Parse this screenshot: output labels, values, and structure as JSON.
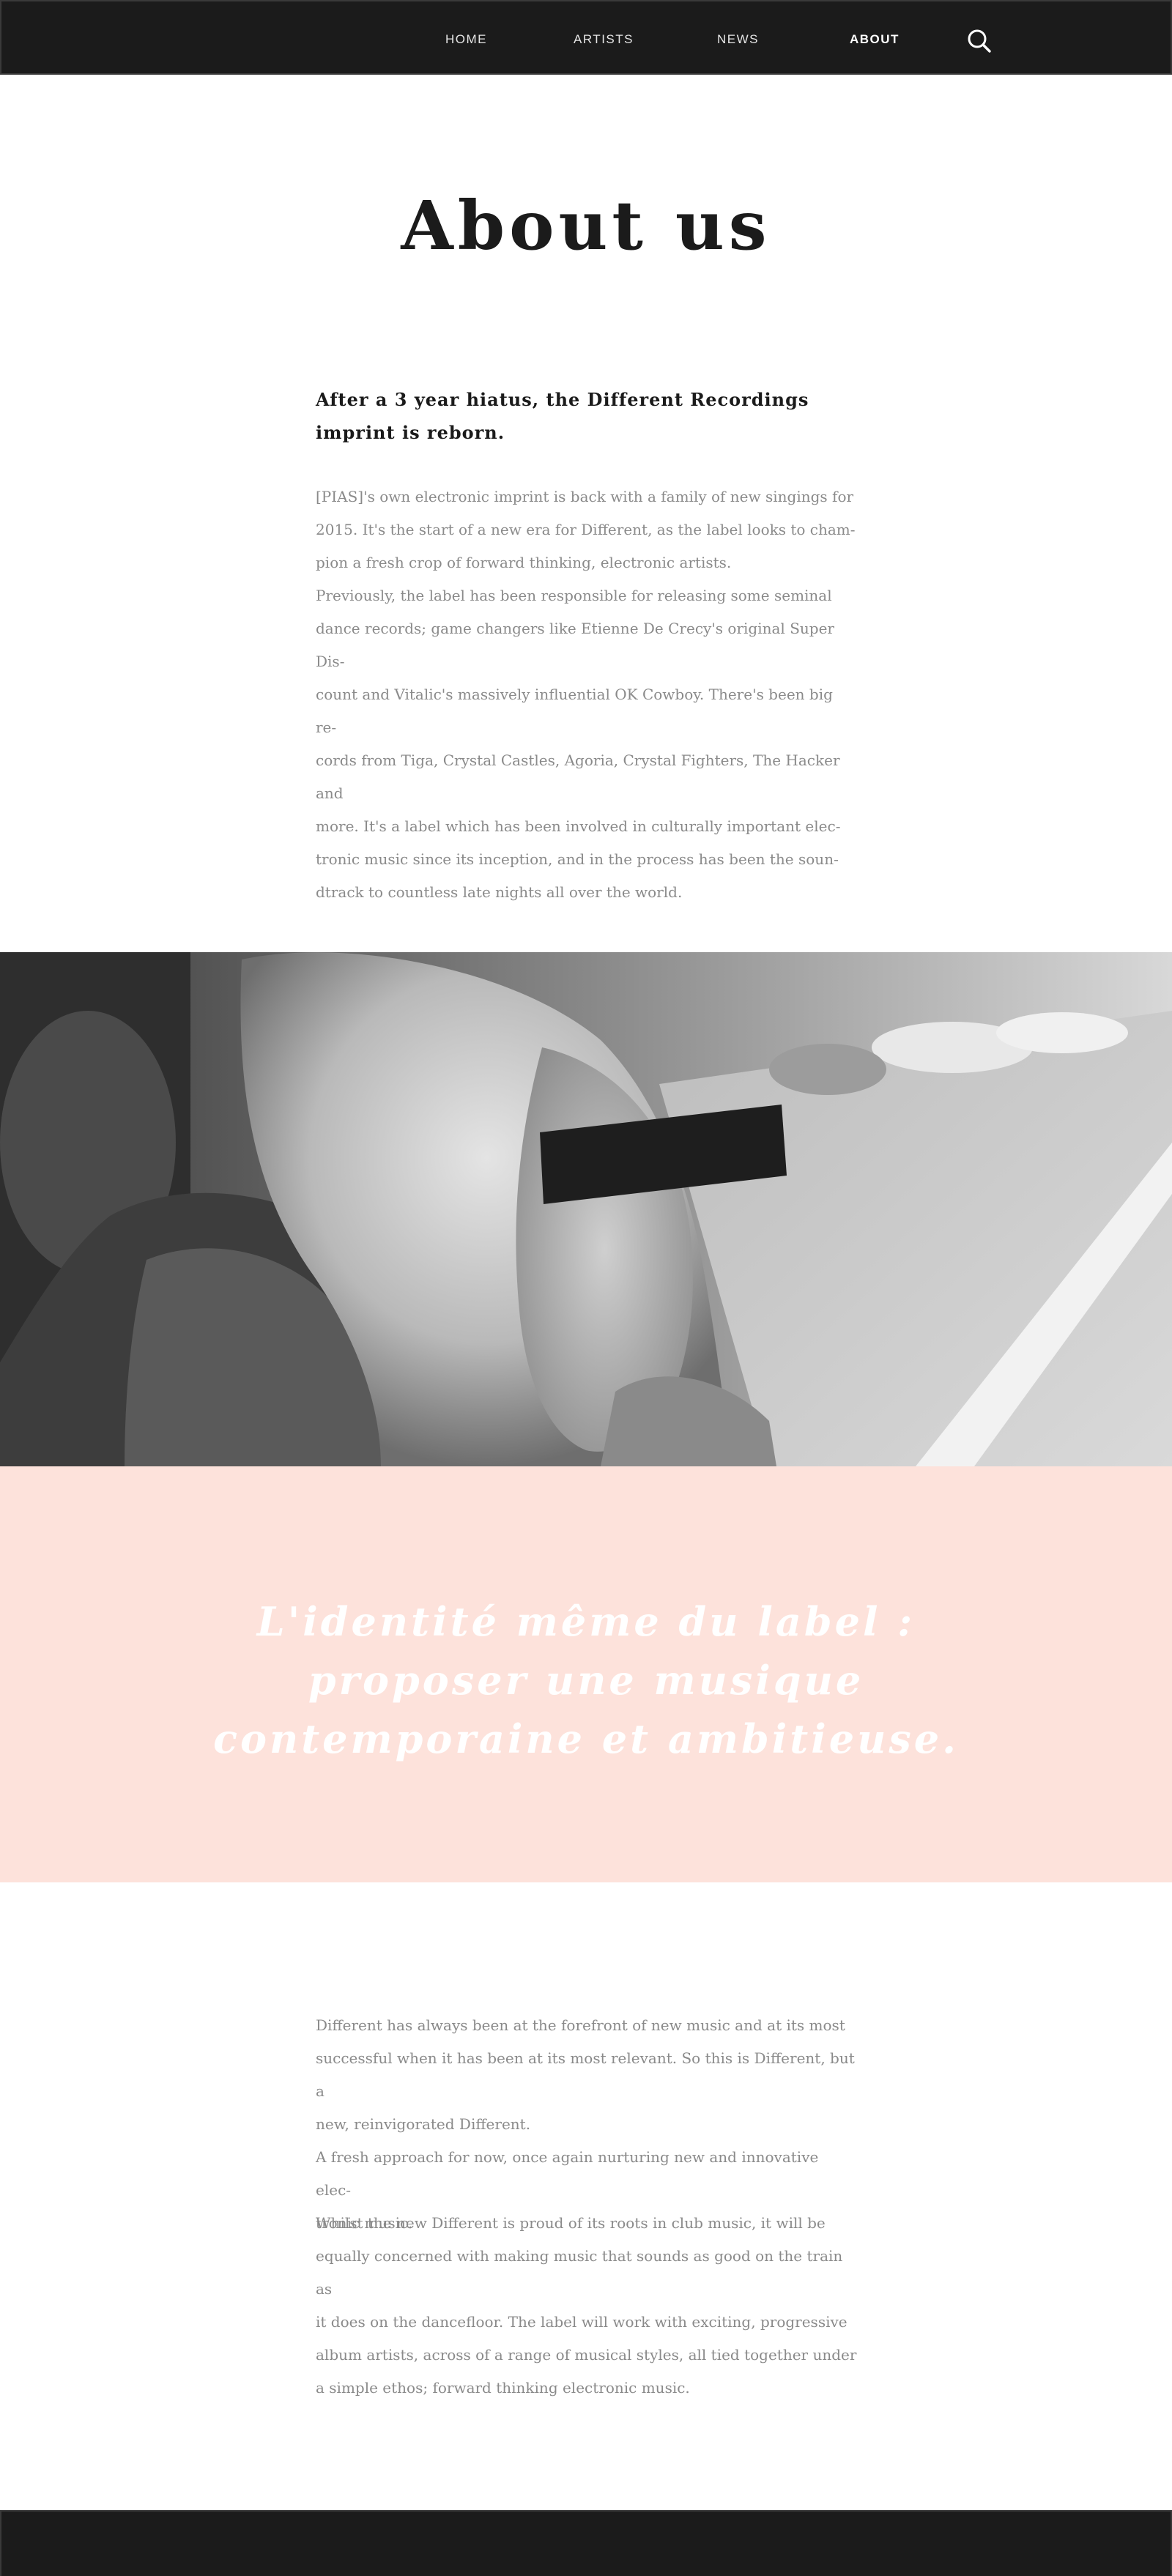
{
  "nav": {
    "items": [
      {
        "label": "HOME"
      },
      {
        "label": "ARTISTS"
      },
      {
        "label": "NEWS"
      },
      {
        "label": "ABOUT",
        "active": true
      }
    ],
    "search_icon": "search-icon"
  },
  "intro": {
    "title": "About us",
    "subhead": "After a 3 year hiatus, the Different Recordings imprint is reborn.",
    "lines": [
      "[PIAS]'s own electronic imprint is back with a family of new singings for",
      "2015. It's the start of a new era for Different, as the label looks to cham-",
      "pion a fresh crop of forward thinking, electronic artists.",
      "Previously, the label has been responsible for releasing some seminal",
      "dance records; game changers like Etienne De Crecy's original Super Dis-",
      "count and Vitalic's massively influential OK Cowboy.  There's been big re-",
      "cords from Tiga, Crystal Castles, Agoria, Crystal Fighters, The Hacker and",
      "more.  It's a label which has been involved in culturally important elec-",
      "tronic music since its inception, and in the process has been the soun-",
      "dtrack to countless late nights all over the world."
    ]
  },
  "quote": {
    "lines": [
      "L'identité même du label :",
      "proposer une musique",
      "contemporaine et ambitieuse."
    ]
  },
  "lower": {
    "para1": [
      "Different has always been at the forefront of new music and at its most",
      "successful when it has been at its most relevant. So this is Different, but a",
      "new, reinvigorated Different.",
      "A fresh approach for now, once again nurturing new and innovative elec-",
      "tronic music."
    ],
    "para2": [
      "Whilst the new Different is proud of its roots in club music, it will be",
      "equally concerned with making music that sounds as good on the train as",
      "it does on the dancefloor. The label will work with exciting, progressive",
      "album artists, across of a range of musical styles, all tied together under",
      "a simple ethos; forward thinking electronic music."
    ]
  },
  "colors": {
    "nav_bg": "#1b1b1b",
    "quote_band": "#fde2db",
    "body_text": "#8a8a8a",
    "heading": "#1b1b1b"
  }
}
